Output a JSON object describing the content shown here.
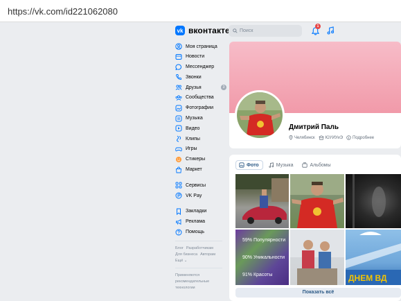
{
  "browser": {
    "url": "https://vk.com/id221062080"
  },
  "header": {
    "logo_text": "вконтакте",
    "search_placeholder": "Поиск",
    "notifications_count": "1"
  },
  "sidebar": {
    "items": [
      {
        "label": "Моя страница",
        "icon": "person-circle-icon"
      },
      {
        "label": "Новости",
        "icon": "news-icon"
      },
      {
        "label": "Мессенджер",
        "icon": "message-icon"
      },
      {
        "label": "Звонки",
        "icon": "phone-icon"
      },
      {
        "label": "Друзья",
        "icon": "friends-icon",
        "count": "3"
      },
      {
        "label": "Сообщества",
        "icon": "communities-icon"
      },
      {
        "label": "Фотографии",
        "icon": "photo-icon"
      },
      {
        "label": "Музыка",
        "icon": "music-icon"
      },
      {
        "label": "Видео",
        "icon": "video-icon"
      },
      {
        "label": "Клипы",
        "icon": "clips-icon"
      },
      {
        "label": "Игры",
        "icon": "gamepad-icon"
      },
      {
        "label": "Стикеры",
        "icon": "sticker-icon"
      },
      {
        "label": "Маркет",
        "icon": "market-icon"
      }
    ],
    "items2": [
      {
        "label": "Сервисы",
        "icon": "services-icon"
      },
      {
        "label": "VK Pay",
        "icon": "vkpay-icon"
      }
    ],
    "items3": [
      {
        "label": "Закладки",
        "icon": "bookmark-icon"
      },
      {
        "label": "Реклама",
        "icon": "megaphone-icon"
      },
      {
        "label": "Помощь",
        "icon": "help-icon"
      }
    ],
    "footer_links": [
      "Блог",
      "Разработчикам",
      "Для бизнеса",
      "Авторам",
      "Ещё ⌄"
    ],
    "footer_note": "Применяются рекомендательные технологии"
  },
  "profile": {
    "name": "Дмитрий Паль",
    "city": "Челябинск",
    "university": "ЮУИУиЭ",
    "details_label": "Подробнее"
  },
  "photos": {
    "tabs": [
      "Фото",
      "Музыка",
      "Альбомы"
    ],
    "overlay_lines": [
      "59% Популярности",
      "90% Уникальности",
      "91% Красоты"
    ],
    "poster_text": "ДНЕМ ВД",
    "show_all": "Показать всё"
  },
  "colors": {
    "accent": "#0077ff",
    "link": "#2a5885",
    "cover": "#f4a9b7"
  }
}
